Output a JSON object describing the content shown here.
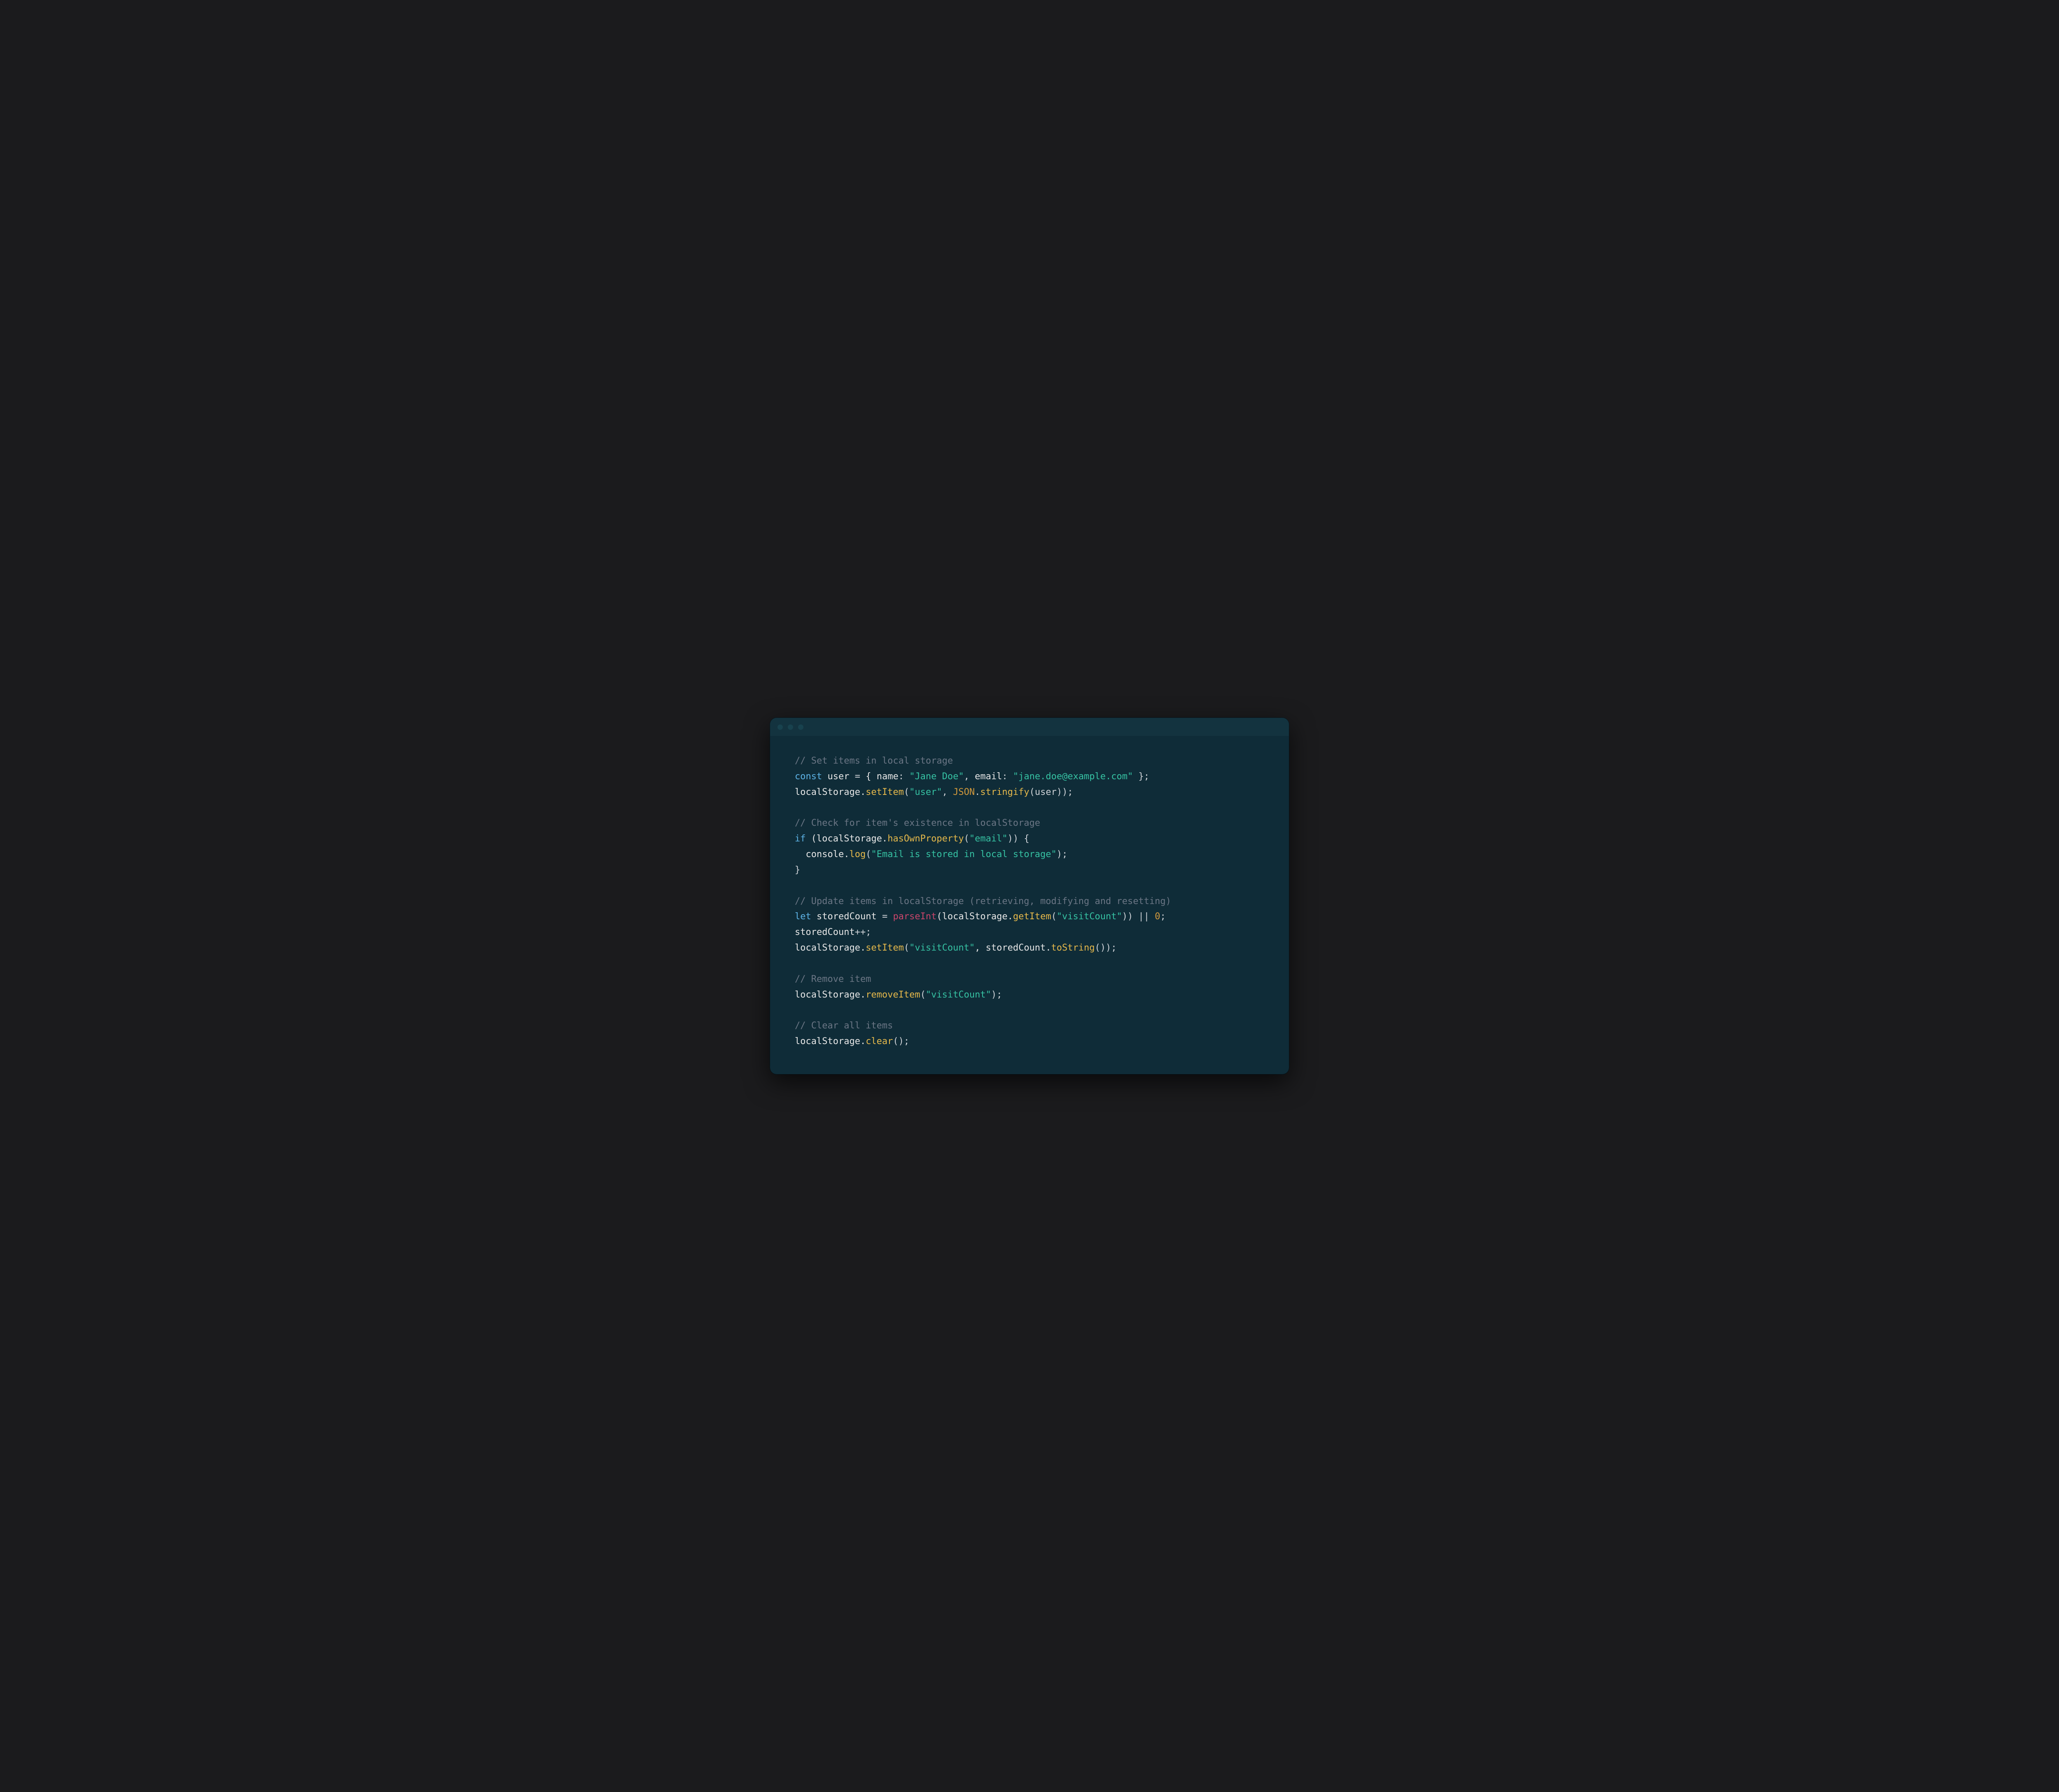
{
  "code": {
    "c1": "// Set items in local storage",
    "l2_1": "const",
    "l2_2": " user ",
    "l2_3": "=",
    "l2_4": " { name",
    "l2_5": ":",
    "l2_6": "\"Jane Doe\"",
    "l2_7": ",",
    "l2_8": " email",
    "l2_9": ":",
    "l2_10": "\"jane.doe@example.com\"",
    "l2_11": " };",
    "l3_1": "localStorage.",
    "l3_2": "setItem",
    "l3_3": "(",
    "l3_4": "\"user\"",
    "l3_5": ", ",
    "l3_6": "JSON",
    "l3_7": ".",
    "l3_8": "stringify",
    "l3_9": "(user));",
    "c2": "// Check for item's existence in localStorage",
    "l5_1": "if",
    "l5_2": " (localStorage.",
    "l5_3": "hasOwnProperty",
    "l5_4": "(",
    "l5_5": "\"email\"",
    "l5_6": ")) {",
    "l6_1": "  console.",
    "l6_2": "log",
    "l6_3": "(",
    "l6_4": "\"Email is stored in local storage\"",
    "l6_5": ");",
    "l7_1": "}",
    "c3": "// Update items in localStorage (retrieving, modifying and resetting)",
    "l9_1": "let",
    "l9_2": " storedCount ",
    "l9_3": "=",
    "l9_4": "parseInt",
    "l9_5": "(localStorage.",
    "l9_6": "getItem",
    "l9_7": "(",
    "l9_8": "\"visitCount\"",
    "l9_9": ")) ",
    "l9_10": "||",
    "l9_11": "0",
    "l9_12": ";",
    "l10_1": "storedCount",
    "l10_2": "++;",
    "l11_1": "localStorage.",
    "l11_2": "setItem",
    "l11_3": "(",
    "l11_4": "\"visitCount\"",
    "l11_5": ", storedCount.",
    "l11_6": "toString",
    "l11_7": "());",
    "c4": "// Remove item",
    "l13_1": "localStorage.",
    "l13_2": "removeItem",
    "l13_3": "(",
    "l13_4": "\"visitCount\"",
    "l13_5": ");",
    "c5": "// Clear all items",
    "l15_1": "localStorage.",
    "l15_2": "clear",
    "l15_3": "();"
  }
}
